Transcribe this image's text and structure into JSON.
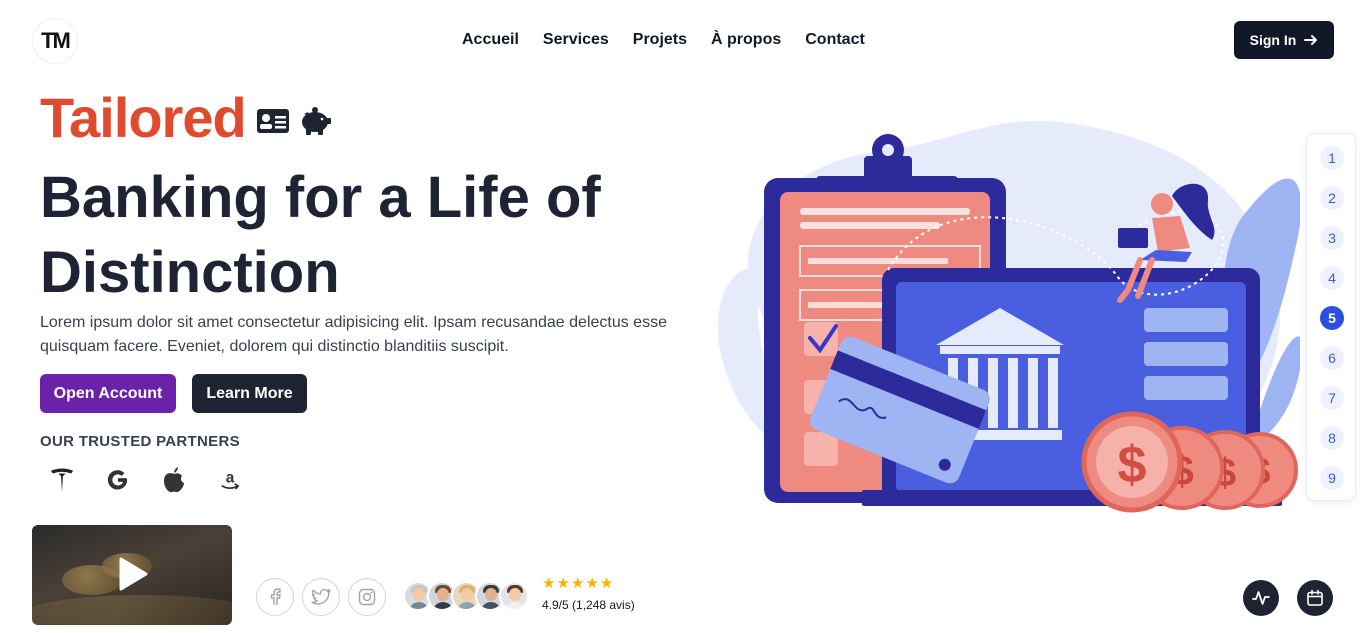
{
  "header": {
    "logo_text": "TM",
    "nav": [
      "Accueil",
      "Services",
      "Projets",
      "À propos",
      "Contact"
    ],
    "signin_label": "Sign In",
    "signin_icon": "arrow-right-icon"
  },
  "hero": {
    "tailored": "Tailored",
    "tailored_icons": [
      "id-card-icon",
      "piggy-bank-icon"
    ],
    "headline_line1": "Banking for a Life of",
    "headline_line2": "Distinction",
    "description": "Lorem ipsum dolor sit amet consectetur adipisicing elit. Ipsam recusandae delectus esse quisquam facere. Eveniet, dolorem qui distinctio blanditiis suscipit.",
    "open_account_label": "Open Account",
    "learn_more_label": "Learn More",
    "partners_title": "OUR TRUSTED PARTNERS",
    "partners": [
      "tesla-icon",
      "google-icon",
      "apple-icon",
      "amazon-icon"
    ]
  },
  "bottom": {
    "video_icon": "play-icon",
    "socials": [
      "facebook-icon",
      "twitter-icon",
      "instagram-icon"
    ],
    "stars": "★★★★★",
    "rating_text": "4.9/5 (1,248 avis)",
    "activity_icon": "activity-icon",
    "calendar_icon": "calendar-icon"
  },
  "pagination": {
    "pages": [
      "1",
      "2",
      "3",
      "4",
      "5",
      "6",
      "7",
      "8",
      "9"
    ],
    "active": "5"
  },
  "colors": {
    "accent": "#e04a2f",
    "primary_button": "#6b21a8",
    "dark": "#1f2433",
    "pager_active": "#2c4fe0"
  }
}
